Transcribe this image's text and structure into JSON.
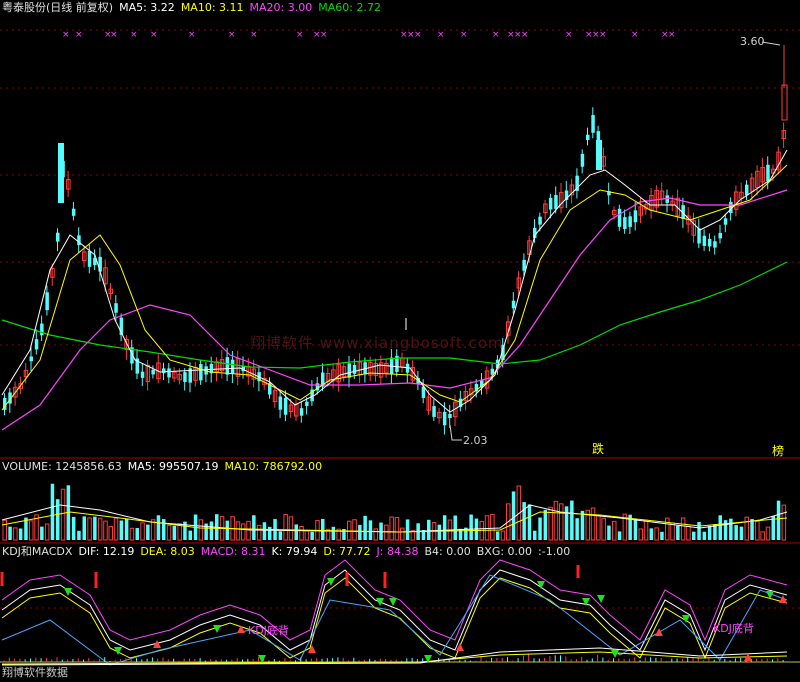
{
  "header": {
    "title": "粤泰股份(日线 前复权)",
    "ma5": "MA5: 3.22",
    "ma10": "MA10: 3.11",
    "ma20": "MA20: 3.00",
    "ma60": "MA60: 2.72"
  },
  "volume_header": {
    "label": "VOLUME: 1245856.63",
    "ma5": "MA5: 995507.19",
    "ma10": "MA10: 786792.00"
  },
  "indicator_header": {
    "name": "KDJ和MACDX",
    "dif": "DIF: 12.19",
    "dea": "DEA: 8.03",
    "macd": "MACD: 8.31",
    "k": "K: 79.94",
    "d": "D: 77.72",
    "j": "J: 84.38",
    "b4": "B4: 0.00",
    "bxg": "BXG: 0.00",
    "extra": ":-1.00"
  },
  "annotations": {
    "high_price": "3.60",
    "low_price": "2.03",
    "fall_tag": "跌",
    "rank_tag": "榜",
    "kdj_bottom_1": "KDJ底背",
    "kdj_bottom_2": "KDJ底背",
    "footer_text": "翔博软件数据"
  },
  "watermark": "翔博软件 www.xiangbosoft.com",
  "colors": {
    "background": "#000000",
    "up_candle": "#ff3c3c",
    "down_candle": "#54fcfc",
    "ma5": "#ffffff",
    "ma10": "#ffff00",
    "ma20": "#ff44ff",
    "ma60": "#00dd00",
    "grid": "#8b0000"
  }
}
